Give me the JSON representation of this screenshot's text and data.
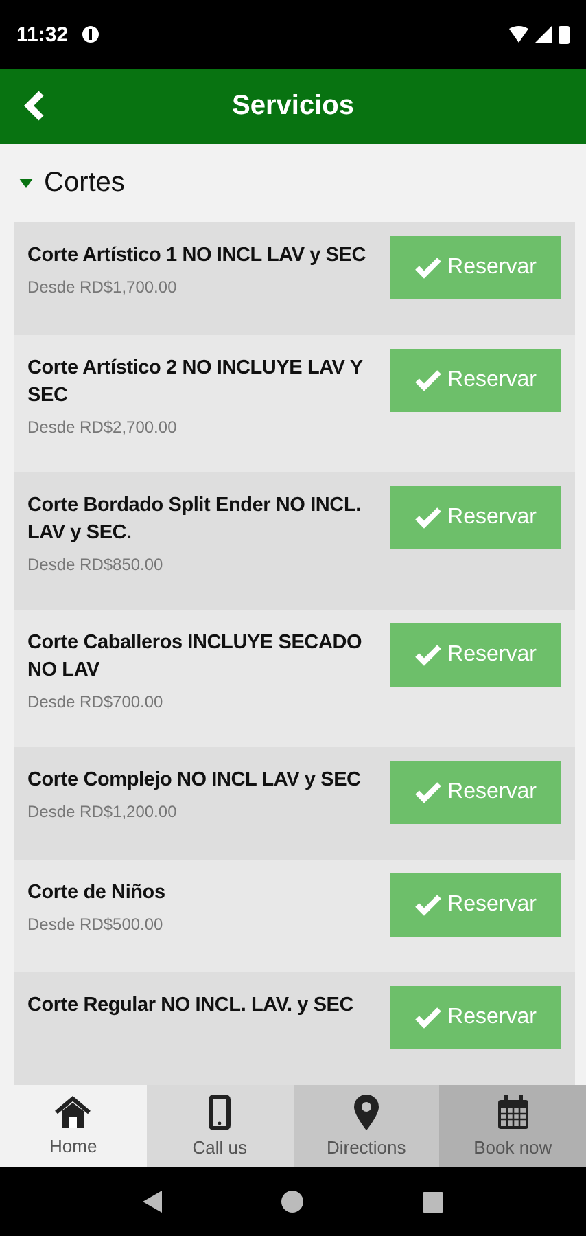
{
  "status_bar": {
    "time": "11:32"
  },
  "header": {
    "title": "Servicios"
  },
  "section": {
    "title": "Cortes",
    "expanded": true
  },
  "services": [
    {
      "name": "Corte Artístico 1 NO INCL LAV y SEC",
      "price": "Desde RD$1,700.00",
      "button": "Reservar"
    },
    {
      "name": "Corte Artístico 2 NO INCLUYE LAV Y SEC",
      "price": "Desde RD$2,700.00",
      "button": "Reservar"
    },
    {
      "name": "Corte Bordado Split Ender NO INCL. LAV y SEC.",
      "price": "Desde RD$850.00",
      "button": "Reservar"
    },
    {
      "name": "Corte Caballeros INCLUYE SECADO NO LAV",
      "price": "Desde RD$700.00",
      "button": "Reservar"
    },
    {
      "name": "Corte Complejo NO INCL LAV y SEC",
      "price": "Desde RD$1,200.00",
      "button": "Reservar"
    },
    {
      "name": "Corte de Niños",
      "price": "Desde RD$500.00",
      "button": "Reservar"
    },
    {
      "name": "Corte Regular NO INCL. LAV. y SEC",
      "button": "Reservar"
    }
  ],
  "bottom_nav": [
    {
      "label": "Home",
      "kind": "home",
      "selected": true
    },
    {
      "label": "Call us",
      "kind": "phone",
      "selected": false
    },
    {
      "label": "Directions",
      "kind": "pin",
      "selected": false
    },
    {
      "label": "Book now",
      "kind": "calendar",
      "selected": false
    }
  ]
}
